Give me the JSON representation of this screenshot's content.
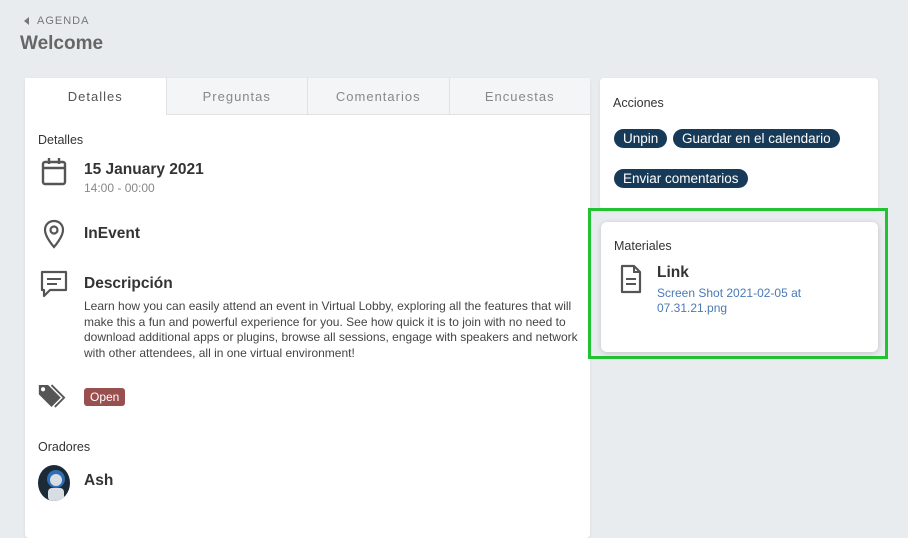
{
  "header": {
    "back_label": "AGENDA",
    "title": "Welcome"
  },
  "tabs": [
    "Detalles",
    "Preguntas",
    "Comentarios",
    "Encuestas"
  ],
  "details": {
    "section_label": "Detalles",
    "date": "15 January 2021",
    "time": "14:00 - 00:00",
    "location": "InEvent",
    "description_title": "Descripción",
    "description_text": "Learn how you can easily attend an event in Virtual Lobby, exploring all the features that will make this a fun and powerful experience for you. See how quick it is to join with no need to download additional apps or plugins, browse all sessions, engage with speakers and network with other attendees, all in one virtual environment!",
    "tag": "Open",
    "speakers_label": "Oradores",
    "speaker_name": "Ash"
  },
  "actions": {
    "title": "Acciones",
    "unpin": "Unpin",
    "save_calendar": "Guardar en el calendario",
    "send_feedback": "Enviar comentarios"
  },
  "materials": {
    "title": "Materiales",
    "link_title": "Link",
    "file_name": "Screen Shot 2021-02-05 at 07.31.21.png"
  },
  "colors": {
    "accent_pill": "#163a57",
    "tag_badge": "#9a4f4f",
    "highlight": "#22c232",
    "file_link": "#4a7ab5"
  }
}
